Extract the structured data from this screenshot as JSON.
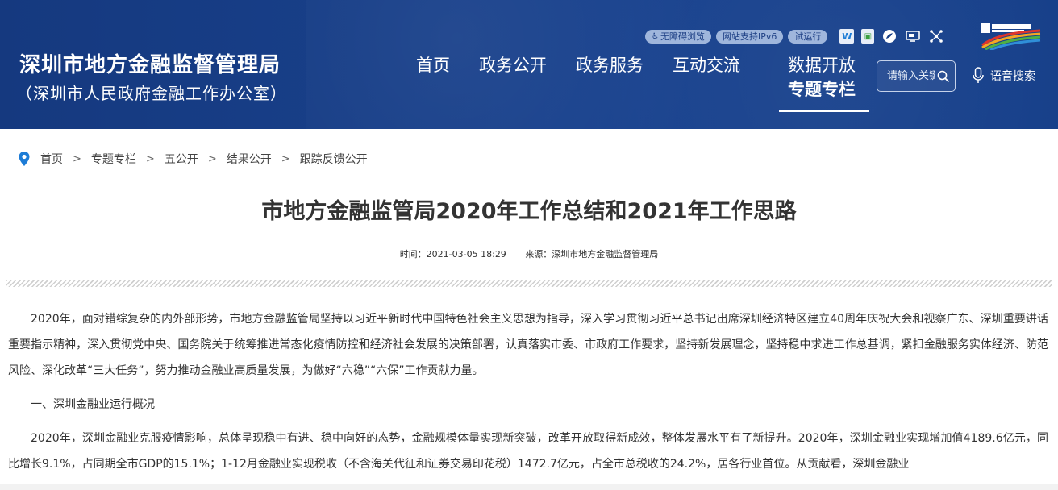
{
  "header": {
    "site_title": "深圳市地方金融监督管理局",
    "site_subtitle": "（深圳市人民政府金融工作办公室）",
    "util_pills": [
      "无障碍浏览",
      "网站支持IPv6",
      "试运行"
    ],
    "icons": [
      "accessibility-icon",
      "weibo-square-icon",
      "wechat-icon",
      "tv-icon",
      "network-icon"
    ],
    "brand_color": "#173e86"
  },
  "nav": {
    "items": [
      "首页",
      "政务公开",
      "政务服务",
      "互动交流"
    ],
    "stack_top": "数据开放",
    "stack_bottom": "专题专栏"
  },
  "search": {
    "placeholder": "请输入关键字",
    "voice_label": "语音搜索"
  },
  "breadcrumb": [
    "首页",
    "专题专栏",
    "五公开",
    "结果公开",
    "跟踪反馈公开"
  ],
  "breadcrumb_sep": ">",
  "article": {
    "title": "市地方金融监管局2020年工作总结和2021年工作思路",
    "time": "时间：2021-03-05 18:29",
    "source": "来源：深圳市地方金融监督管理局",
    "paragraphs": [
      "2020年，面对错综复杂的内外部形势，市地方金融监管局坚持以习近平新时代中国特色社会主义思想为指导，深入学习贯彻习近平总书记出席深圳经济特区建立40周年庆祝大会和视察广东、深圳重要讲话重要指示精神，深入贯彻党中央、国务院关于统筹推进常态化疫情防控和经济社会发展的决策部署，认真落实市委、市政府工作要求，坚持新发展理念，坚持稳中求进工作总基调，紧扣金融服务实体经济、防范风险、深化改革“三大任务”，努力推动金融业高质量发展，为做好“六稳”“六保”工作贡献力量。",
      "一、深圳金融业运行概况",
      "2020年，深圳金融业克服疫情影响，总体呈现稳中有进、稳中向好的态势，金融规模体量实现新突破，改革开放取得新成效，整体发展水平有了新提升。2020年，深圳金融业实现增加值4189.6亿元，同比增长9.1%，占同期全市GDP的15.1%；1-12月金融业实现税收（不含海关代征和证券交易印花税）1472.7亿元，占全市总税收的24.2%，居各行业首位。从贡献看，深圳金融业"
    ]
  }
}
